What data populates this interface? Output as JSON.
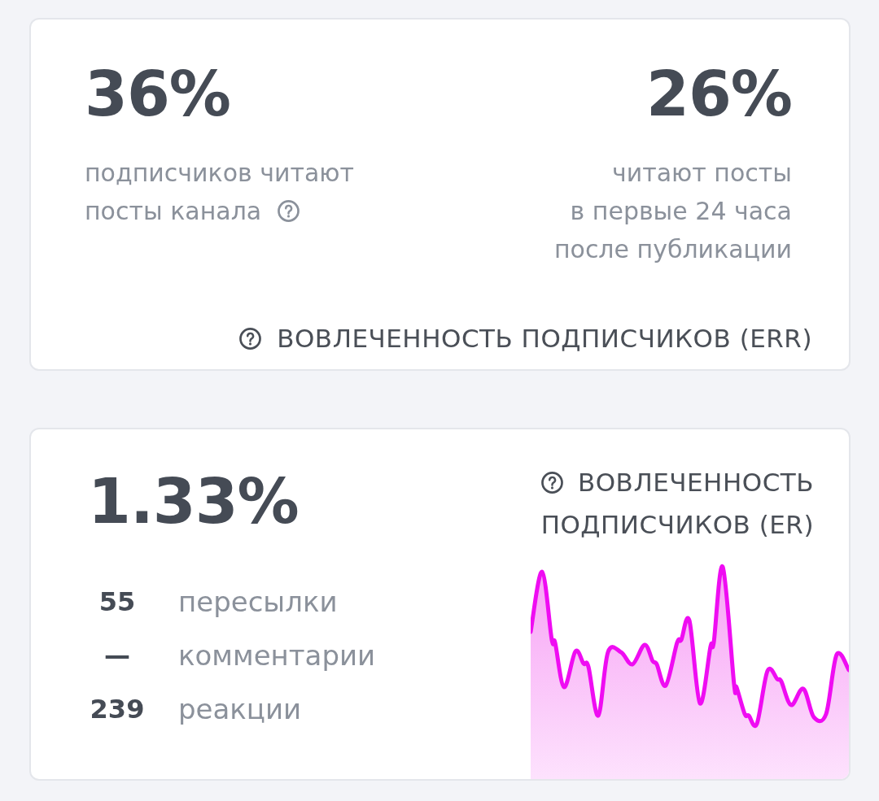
{
  "reach_card": {
    "stats": [
      {
        "value": "36%",
        "description_lines": [
          "подписчиков читают",
          "посты канала"
        ],
        "help_icon": true
      },
      {
        "value": "26%",
        "description_lines": [
          "читают посты",
          "в первые 24 часа",
          "после публикации"
        ],
        "help_icon": false
      }
    ],
    "footer": {
      "label": "ВОВЛЕЧЕННОСТЬ ПОДПИСЧИКОВ (ERR)"
    }
  },
  "engagement_card": {
    "value": "1.33%",
    "metrics": [
      {
        "count": "55",
        "label": "пересылки"
      },
      {
        "count": "—",
        "label": "комментарии"
      },
      {
        "count": "239",
        "label": "реакции"
      }
    ],
    "title_lines": [
      "ВОВЛЕЧЕННОСТЬ",
      "ПОДПИСЧИКОВ (ER)"
    ]
  }
}
